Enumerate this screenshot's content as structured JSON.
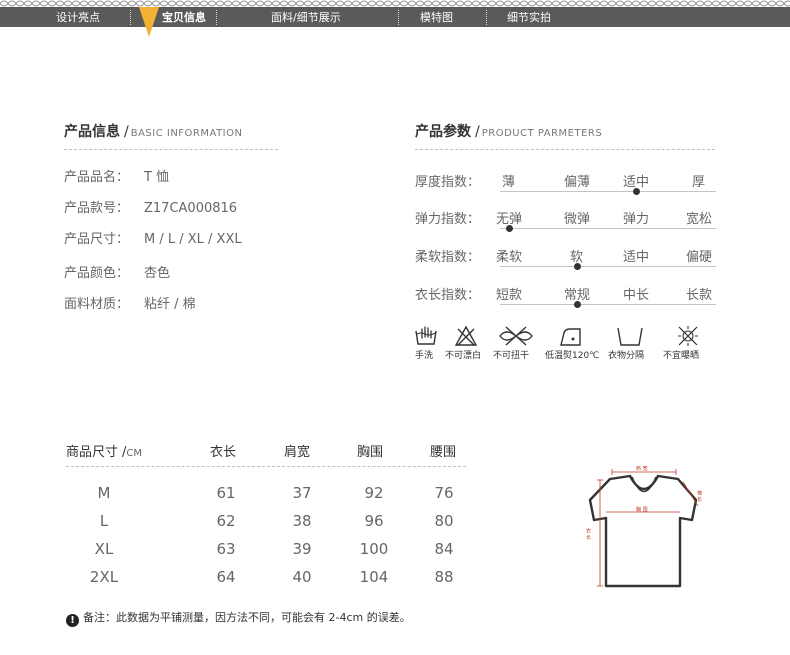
{
  "nav": {
    "items": [
      {
        "label": "设计亮点"
      },
      {
        "label": "宝贝信息"
      },
      {
        "label": "面料/细节展示"
      },
      {
        "label": "模特图"
      },
      {
        "label": "细节实拍"
      }
    ],
    "active_index": 1,
    "bar_color": "#5a5a5a",
    "marker_color": "#f2b233"
  },
  "product_info": {
    "title": "产品信息",
    "subtitle": "BASIC INFORMATION",
    "rows": [
      {
        "label": "产品品名：",
        "value": "T 恤"
      },
      {
        "label": "产品款号：",
        "value": "Z17CA000816"
      },
      {
        "label": "产品尺寸：",
        "value": "M / L / XL / XXL"
      },
      {
        "label": "产品颜色：",
        "value": "杏色"
      },
      {
        "label": "面料材质：",
        "value": "粘纤 / 棉"
      }
    ]
  },
  "product_params": {
    "title": "产品参数",
    "subtitle": "PRODUCT PARMETERS",
    "rows": [
      {
        "label": "厚度指数：",
        "options": [
          "薄",
          "偏薄",
          "适中",
          "厚"
        ],
        "selected": 2
      },
      {
        "label": "弹力指数：",
        "options": [
          "无弹",
          "微弹",
          "弹力",
          "宽松"
        ],
        "selected": 0
      },
      {
        "label": "柔软指数：",
        "options": [
          "柔软",
          "软",
          "适中",
          "偏硬"
        ],
        "selected": 1
      },
      {
        "label": "衣长指数：",
        "options": [
          "短款",
          "常规",
          "中长",
          "长款"
        ],
        "selected": 1
      }
    ]
  },
  "care": [
    {
      "icon": "hand-wash-icon",
      "label": "手洗"
    },
    {
      "icon": "no-bleach-icon",
      "label": "不可漂白"
    },
    {
      "icon": "no-wring-icon",
      "label": "不可扭干"
    },
    {
      "icon": "low-iron-icon",
      "label": "低温熨120℃"
    },
    {
      "icon": "flat-dry-icon",
      "label": "衣物分隔"
    },
    {
      "icon": "no-sun-dry-icon",
      "label": "不宜曝晒"
    }
  ],
  "size_table": {
    "title": "商品尺寸",
    "unit": "CM",
    "columns": [
      "衣长",
      "肩宽",
      "胸围",
      "腰围"
    ],
    "rows": [
      {
        "size": "M",
        "values": [
          "61",
          "37",
          "92",
          "76"
        ]
      },
      {
        "size": "L",
        "values": [
          "62",
          "38",
          "96",
          "80"
        ]
      },
      {
        "size": "XL",
        "values": [
          "63",
          "39",
          "100",
          "84"
        ]
      },
      {
        "size": "2XL",
        "values": [
          "64",
          "40",
          "104",
          "88"
        ]
      }
    ]
  },
  "diagram": {
    "shoulder_label": "肩 宽",
    "chest_label": "胸 围",
    "length_label": "衣 长",
    "sleeve_label": "袖 长",
    "accent_color": "#c0392b"
  },
  "note": {
    "text": "备注：此数据为平铺测量，因方法不同，可能会有 2-4cm 的误差。",
    "icon": "exclamation-icon"
  }
}
